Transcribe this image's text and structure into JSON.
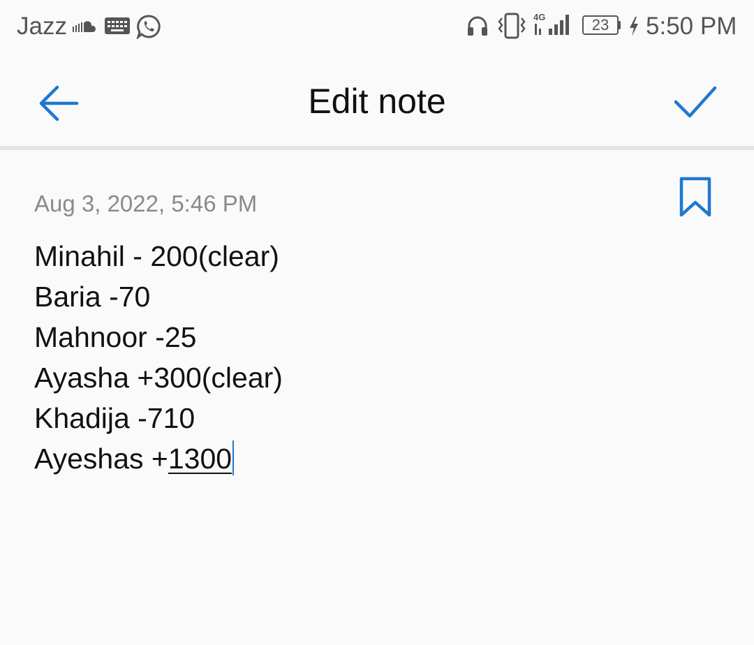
{
  "status_bar": {
    "carrier": "Jazz",
    "battery_level": "23",
    "time": "5:50 PM",
    "network_type": "4G",
    "icons": [
      "soundcloud-icon",
      "keyboard-icon",
      "whatsapp-icon",
      "headphones-icon",
      "vibrate-icon",
      "signal-icon",
      "charging-icon"
    ]
  },
  "app_bar": {
    "title": "Edit note",
    "back_icon": "arrow-left-icon",
    "done_icon": "check-icon"
  },
  "note": {
    "date": "Aug 3, 2022, 5:46 PM",
    "bookmark_icon": "bookmark-icon",
    "lines": [
      "Minahil - 200(clear)",
      "Baria -70",
      "Mahnoor -25",
      "Ayasha +300(clear)",
      "Khadija -710"
    ],
    "last_line_prefix": "Ayeshas +",
    "last_line_composing": "1300"
  },
  "colors": {
    "accent": "#1f78d1",
    "text": "#111111",
    "secondary_text": "#8a8a8a",
    "background": "#fafafa",
    "divider": "#e3e3e3"
  }
}
